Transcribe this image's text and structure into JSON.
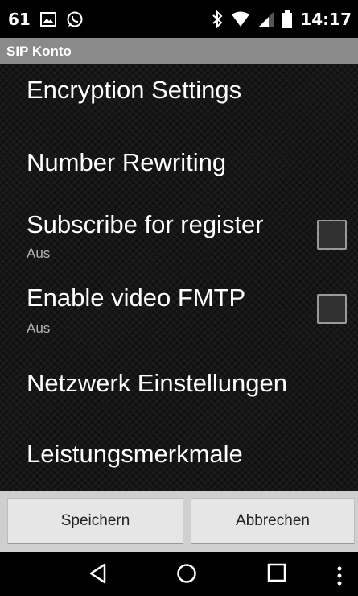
{
  "status_bar": {
    "notification_count": "61",
    "image_icon": "image-icon",
    "whatsapp_icon": "whatsapp-icon",
    "bluetooth_icon": "bluetooth-icon",
    "wifi_icon": "wifi-icon",
    "signal_icon": "signal-icon",
    "battery_icon": "battery-icon",
    "time": "14:17"
  },
  "title_bar": {
    "title": "SIP Konto"
  },
  "preferences": [
    {
      "title": "Encryption Settings"
    },
    {
      "title": "Number Rewriting"
    },
    {
      "title": "Subscribe for register",
      "summary": "Aus",
      "checked": false
    },
    {
      "title": "Enable video FMTP",
      "summary": "Aus",
      "checked": false
    },
    {
      "title": "Netzwerk Einstellungen"
    },
    {
      "title": "Leistungsmerkmale"
    }
  ],
  "buttons": {
    "save": "Speichern",
    "cancel": "Abbrechen"
  },
  "nav_bar": {
    "back_icon": "back-icon",
    "home_icon": "home-icon",
    "recents_icon": "recents-icon",
    "overflow_icon": "overflow-menu-icon"
  },
  "colors": {
    "title_bar": "#8a8a8a",
    "background": "#161616",
    "button_bar": "#cfcfcf",
    "summary_text": "#b5b5b5"
  }
}
